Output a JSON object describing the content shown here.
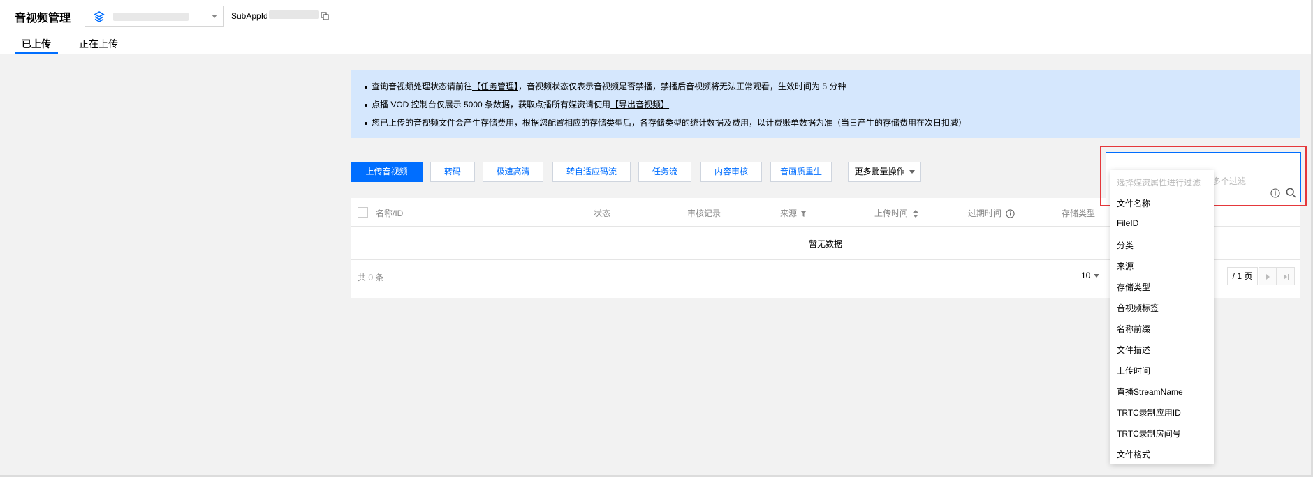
{
  "header": {
    "title": "音视频管理",
    "subapp_label": "SubAppId"
  },
  "tabs": [
    {
      "label": "已上传",
      "active": true
    },
    {
      "label": "正在上传",
      "active": false
    }
  ],
  "notices": [
    {
      "pre": "查询音视频处理状态请前往",
      "link": "【任务管理】",
      "post": "，音视频状态仅表示音视频是否禁播，禁播后音视频将无法正常观看，生效时间为 5 分钟"
    },
    {
      "pre": "点播 VOD 控制台仅展示 5000 条数据，获取点播所有媒资请使用",
      "link": "【导出音视频】",
      "post": ""
    },
    {
      "pre": "您已上传的音视频文件会产生存储费用，根据您配置相应的存储类型后，各存储类型的统计数据及费用，以计费账单数据为准（当日产生的存储费用在次日扣减）",
      "link": "",
      "post": ""
    }
  ],
  "toolbar": {
    "upload": "上传音视频",
    "transcode": "转码",
    "tesHD": "极速高清",
    "adaptive": "转自适应码流",
    "taskflow": "任务流",
    "moderation": "内容审核",
    "remaster": "音画质重生",
    "more": "更多批量操作"
  },
  "table": {
    "columns": [
      "名称/ID",
      "状态",
      "审核记录",
      "来源",
      "上传时间",
      "过期时间",
      "存储类型"
    ],
    "empty": "暂无数据",
    "total": "共 0 条",
    "page_size": "10",
    "page_total": "/ 1 页"
  },
  "filter": {
    "placeholder_right": "多个过滤",
    "hint": "选择媒资属性进行过滤",
    "options": [
      "文件名称",
      "FileID",
      "分类",
      "来源",
      "存储类型",
      "音视频标签",
      "名称前缀",
      "文件描述",
      "上传时间",
      "直播StreamName",
      "TRTC录制应用ID",
      "TRTC录制房间号",
      "文件格式"
    ]
  },
  "colors": {
    "primary": "#006eff",
    "notice_bg": "#d5e7fd",
    "highlight": "#e5383b"
  }
}
